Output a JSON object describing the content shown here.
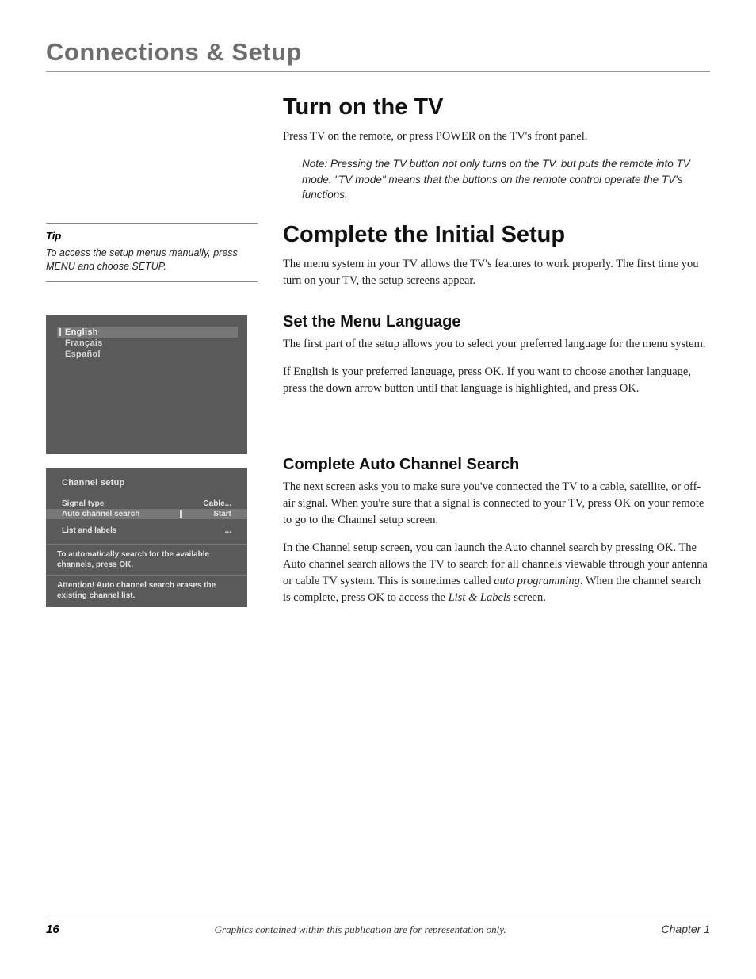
{
  "chapter_head": "Connections & Setup",
  "tip": {
    "title": "Tip",
    "body": "To access the setup menus manually, press MENU and choose SETUP."
  },
  "lang_menu": {
    "items": [
      "English",
      "Français",
      "Español"
    ],
    "selected_index": 0
  },
  "chan_menu": {
    "title": "Channel setup",
    "rows": [
      {
        "left": "Signal type",
        "right": "Cable...",
        "hl": false
      },
      {
        "left": "Auto channel search",
        "right": "Start",
        "hl": true
      },
      {
        "left": "List and labels",
        "right": "...",
        "hl": false
      }
    ],
    "hint1": "To automatically search for the available channels, press OK.",
    "hint2": "Attention! Auto channel search erases the existing channel list."
  },
  "sections": {
    "turn_on": {
      "heading": "Turn on the TV",
      "p1": "Press TV on the remote, or press POWER on the TV's front panel.",
      "note": "Note: Pressing the TV button not only turns on the TV, but puts the remote into TV mode. \"TV mode\" means that the buttons on the remote control operate the TV's functions."
    },
    "complete_setup": {
      "heading": "Complete the Initial Setup",
      "p1": "The menu system in your TV allows the TV's features to work properly. The first time you turn on your TV, the setup screens appear."
    },
    "menu_lang": {
      "heading": "Set the Menu Language",
      "p1": "The first part of the setup allows you to select your preferred language for the menu system.",
      "p2": "If English is your preferred language, press OK. If you want to choose another language, press the down arrow button until that language is highlighted, and press OK."
    },
    "auto_search": {
      "heading": "Complete Auto Channel Search",
      "p1": "The next screen asks you to make sure you've connected the TV to a cable, satellite, or off-air signal. When you're sure that a signal is connected to your TV, press OK on your remote to go to the Channel setup screen.",
      "p2_a": "In the Channel setup screen, you can launch the Auto channel search by pressing OK. The Auto channel search allows the TV to search for all channels viewable through your antenna or cable TV system. This is sometimes called ",
      "p2_ital": "auto programming",
      "p2_b": ". When the channel search is complete, press OK to access the ",
      "p2_ital2": "List & Labels",
      "p2_c": " screen."
    }
  },
  "footer": {
    "page": "16",
    "caption": "Graphics contained within this publication are for representation only.",
    "chapter": "Chapter 1"
  }
}
